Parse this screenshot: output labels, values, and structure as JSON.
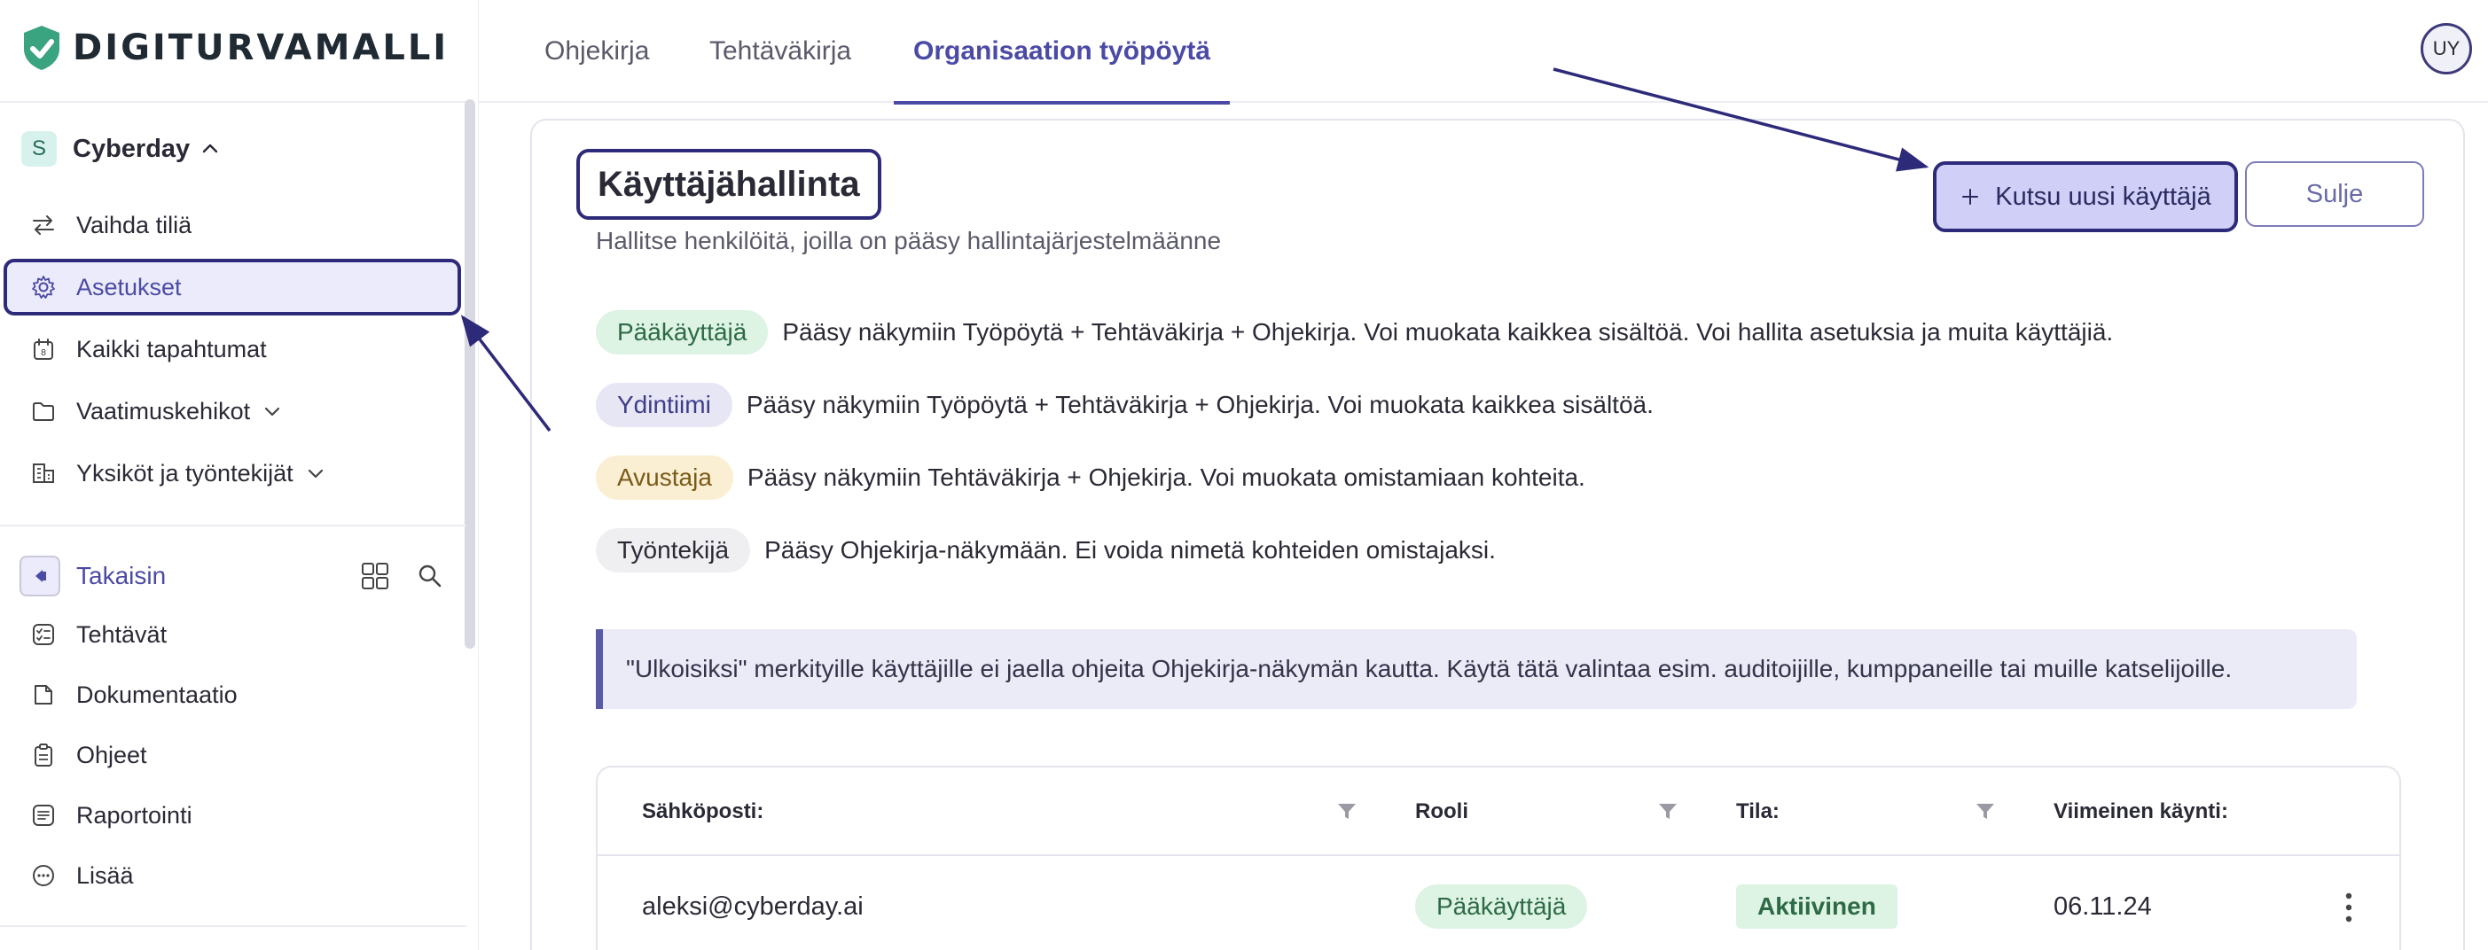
{
  "brand": {
    "name": "DIGITURVAMALLI"
  },
  "nav_tabs": [
    {
      "label": "Ohjekirja",
      "active": false
    },
    {
      "label": "Tehtäväkirja",
      "active": false
    },
    {
      "label": "Organisaation työpöytä",
      "active": true
    }
  ],
  "user": {
    "initials": "UY"
  },
  "sidebar": {
    "org": {
      "badge": "S",
      "name": "Cyberday"
    },
    "items": [
      {
        "label": "Vaihda tiliä",
        "icon": "swap-icon"
      },
      {
        "label": "Asetukset",
        "icon": "gear-icon",
        "active": true
      },
      {
        "label": "Kaikki tapahtumat",
        "icon": "calendar-icon"
      },
      {
        "label": "Vaatimuskehikot",
        "icon": "folder-icon"
      },
      {
        "label": "Yksiköt ja työntekijät",
        "icon": "org-icon"
      }
    ],
    "back_label": "Takaisin",
    "sub_items": [
      {
        "label": "Tehtävät",
        "icon": "checklist-icon"
      },
      {
        "label": "Dokumentaatio",
        "icon": "document-icon"
      },
      {
        "label": "Ohjeet",
        "icon": "clipboard-icon"
      },
      {
        "label": "Raportointi",
        "icon": "report-icon"
      },
      {
        "label": "Lisää",
        "icon": "more-icon"
      }
    ]
  },
  "page": {
    "title": "Käyttäjähallinta",
    "subtitle": "Hallitse henkilöitä, joilla on pääsy hallintajärjestelmäänne",
    "invite_label": "Kutsu uusi käyttäjä",
    "close_label": "Sulje"
  },
  "roles": [
    {
      "name": "Pääkäyttäjä",
      "description": "Pääsy näkymiin Työpöytä + Tehtäväkirja + Ohjekirja. Voi muokata kaikkea sisältöä. Voi hallita asetuksia ja muita käyttäjiä."
    },
    {
      "name": "Ydintiimi",
      "description": "Pääsy näkymiin Työpöytä + Tehtäväkirja + Ohjekirja. Voi muokata kaikkea sisältöä."
    },
    {
      "name": "Avustaja",
      "description": "Pääsy näkymiin Tehtäväkirja + Ohjekirja. Voi muokata omistamiaan kohteita."
    },
    {
      "name": "Työntekijä",
      "description": "Pääsy Ohjekirja‑näkymään. Ei voida nimetä kohteiden omistajaksi."
    }
  ],
  "notice": "\"Ulkoisiksi\" merkityille käyttäjille ei jaella ohjeita Ohjekirja‑näkymän kautta. Käytä tätä valintaa esim. auditoijille, kumppaneille tai muille katselijoille.",
  "table": {
    "columns": [
      "Sähköposti:",
      "Rooli",
      "Tila:",
      "Viimeinen käynti:"
    ],
    "rows": [
      {
        "email": "aleksi@cyberday.ai",
        "role": "Pääkäyttäjä",
        "status": "Aktiivinen",
        "last_visit": "06.11.24"
      }
    ]
  },
  "colors": {
    "accent": "#4b4aa5",
    "annotation": "#2e2a7a",
    "success": "#2d6a45"
  }
}
